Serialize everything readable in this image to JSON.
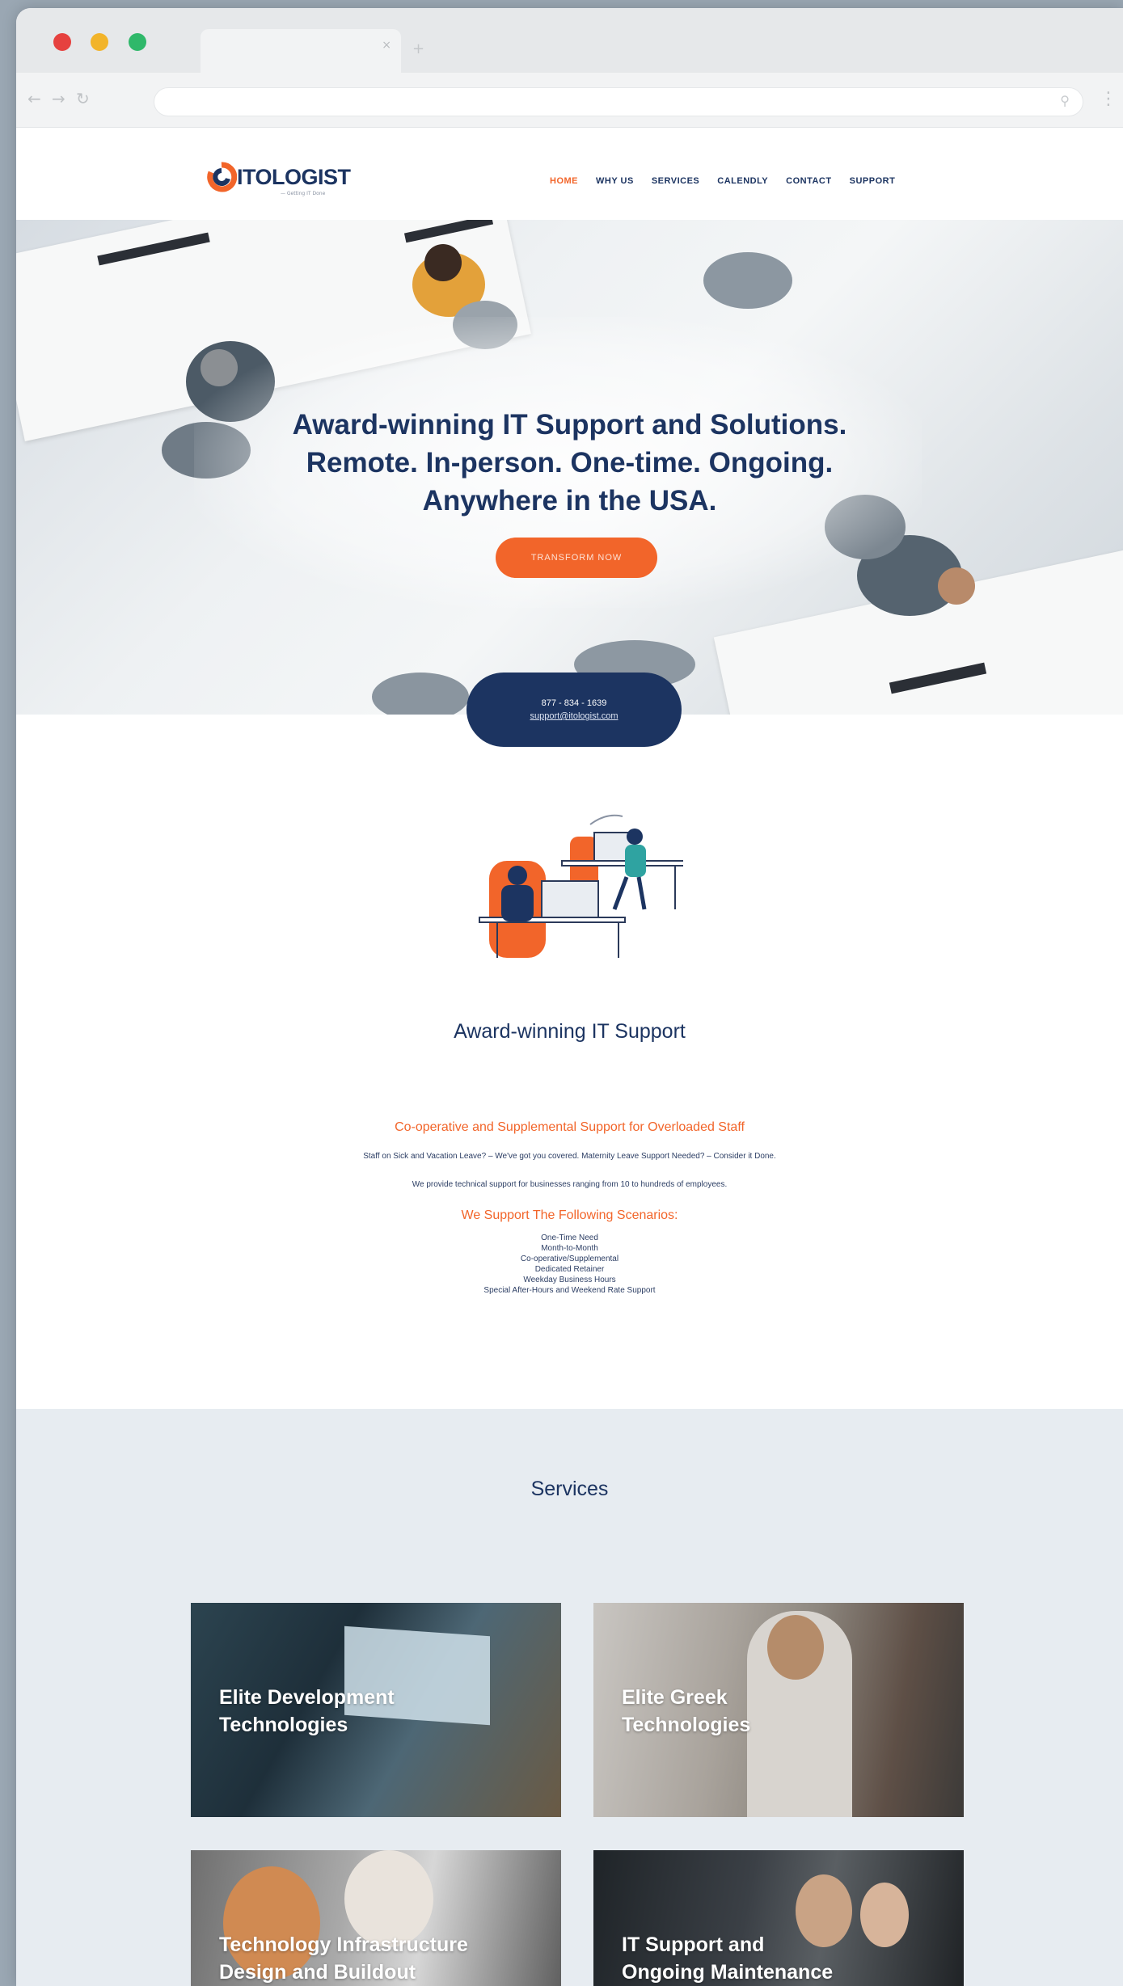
{
  "browser": {
    "tab_close": "×",
    "new_tab": "+",
    "back": "←",
    "forward": "→",
    "reload": "↻",
    "url": "",
    "menu": "⋮"
  },
  "site": {
    "logo_text": "ITOLOGIST",
    "logo_tagline": "— Getting IT Done",
    "nav": [
      {
        "label": "HOME",
        "active": true
      },
      {
        "label": "WHY US"
      },
      {
        "label": "SERVICES"
      },
      {
        "label": "CALENDLY"
      },
      {
        "label": "CONTACT"
      },
      {
        "label": "SUPPORT"
      }
    ]
  },
  "hero": {
    "line1": "Award-winning IT Support and Solutions.",
    "line2": "Remote. In-person. One-time. Ongoing.",
    "line3": "Anywhere in the USA.",
    "cta": "TRANSFORM NOW",
    "phone": "877 - 834 - 1639",
    "email": "support@itologist.com"
  },
  "support": {
    "title": "Award-winning IT Support",
    "heading": "Co-operative and Supplemental Support for Overloaded Staff",
    "line1": "Staff on Sick and Vacation Leave? – We've got you covered. Maternity Leave Support Needed? – Consider it Done.",
    "line2": "We provide technical support for businesses ranging from  10 to hundreds of employees.",
    "scenarios_heading": "We Support The Following Scenarios:",
    "scenarios": [
      "One-Time Need",
      "Month-to-Month",
      "Co-operative/Supplemental",
      "Dedicated Retainer",
      "Weekday Business Hours",
      "Special After-Hours and Weekend Rate Support"
    ]
  },
  "services": {
    "title": "Services",
    "cards": [
      {
        "line1": "Elite Development",
        "line2": "Technologies"
      },
      {
        "line1": "Elite Greek",
        "line2": "Technologies"
      },
      {
        "line1": "Technology Infrastructure",
        "line2": "Design and Buildout"
      },
      {
        "line1": "IT Support and",
        "line2": "Ongoing Maintenance"
      }
    ]
  },
  "colors": {
    "brand_navy": "#1c3461",
    "brand_orange": "#f2652a"
  }
}
